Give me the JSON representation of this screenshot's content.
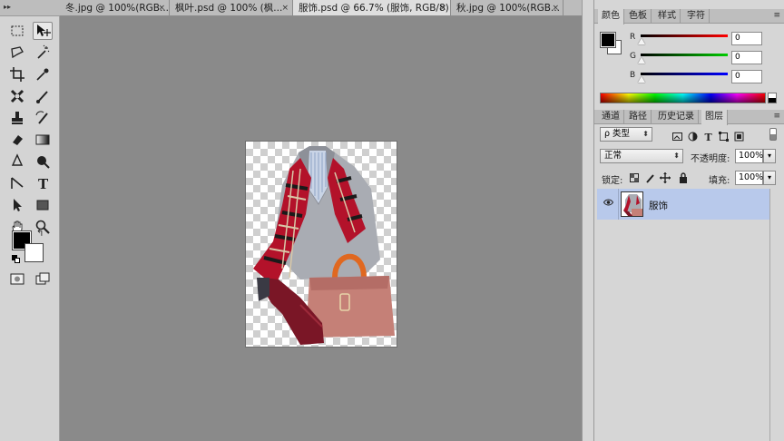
{
  "tabs": [
    {
      "label": "冬.jpg @ 100%(RGB...",
      "close": "×"
    },
    {
      "label": "枫叶.psd @ 100% (枫...",
      "close": "×"
    },
    {
      "label": "服饰.psd @ 66.7% (服饰, RGB/8)",
      "close": "×",
      "active": true
    },
    {
      "label": "秋.jpg @ 100%(RGB...",
      "close": "×"
    }
  ],
  "colorPanel": {
    "tabs": [
      "颜色",
      "色板",
      "样式",
      "字符"
    ],
    "channels": [
      {
        "label": "R",
        "value": "0"
      },
      {
        "label": "G",
        "value": "0"
      },
      {
        "label": "B",
        "value": "0"
      }
    ]
  },
  "layersPanel": {
    "tabs": [
      "通道",
      "路径",
      "历史记录",
      "图层"
    ],
    "filter_label": "ρ 类型",
    "blend_mode": "正常",
    "opacity_label": "不透明度:",
    "opacity_value": "100%",
    "lock_label": "锁定:",
    "fill_label": "填充:",
    "fill_value": "100%",
    "layers": [
      {
        "name": "服饰",
        "visible": true,
        "selected": true
      }
    ]
  },
  "colors": {
    "selection": "#b8c9eb",
    "workspace": "#8a8a8a",
    "panel": "#d6d6d6"
  }
}
